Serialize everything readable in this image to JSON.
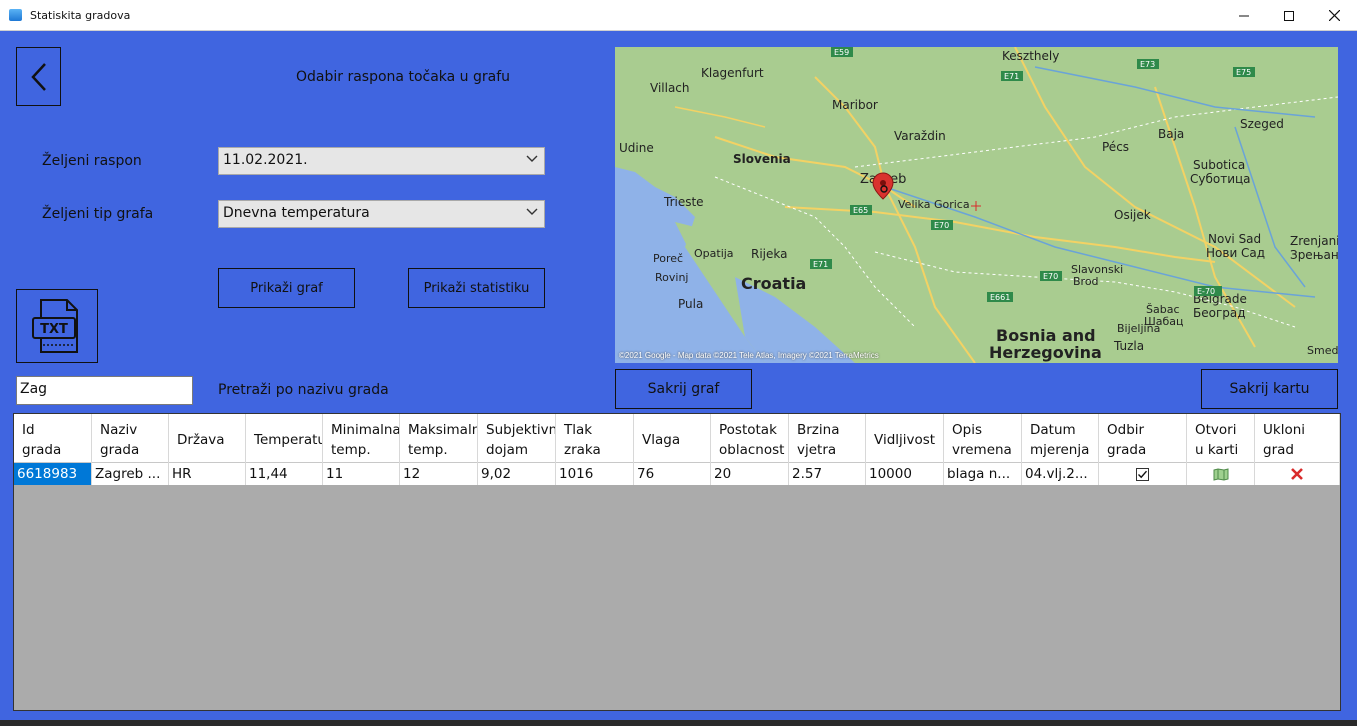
{
  "window": {
    "title": "Statiskita gradova"
  },
  "controls": {
    "heading": "Odabir raspona točaka u grafu",
    "range_label": "Željeni raspon",
    "range_value": "11.02.2021.",
    "type_label": "Željeni tip grafa",
    "type_value": "Dnevna temperatura",
    "show_graph": "Prikaži graf",
    "show_stats": "Prikaži statistiku",
    "txt_label": "TXT",
    "search_value": "Zag",
    "search_label": "Pretraži po nazivu grada",
    "hide_graph": "Sakrij graf",
    "hide_map": "Sakrij kartu"
  },
  "map": {
    "labels": [
      {
        "text": "Keszthely"
      },
      {
        "text": "Klagenfurt"
      },
      {
        "text": "Villach"
      },
      {
        "text": "Maribor"
      },
      {
        "text": "Varaždin"
      },
      {
        "text": "Szeged"
      },
      {
        "text": "Udine"
      },
      {
        "text": "Slovenia"
      },
      {
        "text": "Baja"
      },
      {
        "text": "Pécs"
      },
      {
        "text": "Subotica"
      },
      {
        "text": "Суботица"
      },
      {
        "text": "Zagreb"
      },
      {
        "text": "Trieste"
      },
      {
        "text": "Velika Gorica"
      },
      {
        "text": "Osijek"
      },
      {
        "text": "Novi Sad"
      },
      {
        "text": "Нови Сад"
      },
      {
        "text": "Zrenjani"
      },
      {
        "text": "Зрењани"
      },
      {
        "text": "Poreč"
      },
      {
        "text": "Opatija"
      },
      {
        "text": "Rijeka"
      },
      {
        "text": "Rovinj"
      },
      {
        "text": "Croatia"
      },
      {
        "text": "Slavonski"
      },
      {
        "text": "Brod"
      },
      {
        "text": "Pula"
      },
      {
        "text": "Belgrade"
      },
      {
        "text": "Београд"
      },
      {
        "text": "Šabac"
      },
      {
        "text": "Шабац"
      },
      {
        "text": "Bijeljina"
      },
      {
        "text": "Bosnia and"
      },
      {
        "text": "Herzegovina"
      },
      {
        "text": "Tuzla"
      },
      {
        "text": "Smede"
      }
    ],
    "roads": [
      "E59",
      "E71",
      "E73",
      "E75",
      "E65",
      "E70",
      "E71",
      "E70",
      "E661",
      "E-70"
    ],
    "copyright": "©2021 Google - Map data ©2021 Tele Atlas, Imagery ©2021 TerraMetrics"
  },
  "table": {
    "headers": [
      "Id grada",
      "Naziv grada",
      "Država",
      "Temperatura",
      "Minimalna temp.",
      "Maksimalna temp.",
      "Subjektivni dojam",
      "Tlak zraka",
      "Vlaga",
      "Postotak oblacnosti",
      "Brzina vjetra",
      "Vidljivost",
      "Opis vremena",
      "Datum mjerenja",
      "Odbir grada",
      "Otvori u karti",
      "Ukloni grad"
    ],
    "header_lines": [
      [
        "Id",
        "grada"
      ],
      [
        "Naziv",
        "grada"
      ],
      [
        "Država",
        ""
      ],
      [
        "Temperatu",
        ""
      ],
      [
        "Minimalna",
        "temp."
      ],
      [
        "Maksimaln",
        "temp."
      ],
      [
        "Subjektivn",
        "dojam"
      ],
      [
        "Tlak",
        "zraka"
      ],
      [
        "Vlaga",
        ""
      ],
      [
        "Postotak",
        "oblacnost"
      ],
      [
        "Brzina",
        "vjetra"
      ],
      [
        "Vidljivost",
        ""
      ],
      [
        "Opis",
        "vremena"
      ],
      [
        "Datum",
        "mjerenja"
      ],
      [
        "Odbir",
        "grada"
      ],
      [
        "Otvori",
        "u karti"
      ],
      [
        "Ukloni",
        "grad"
      ]
    ],
    "rows": [
      {
        "id": "6618983",
        "name": "Zagreb ...",
        "country": "HR",
        "temp": "11,44",
        "min": "11",
        "max": "12",
        "feels": "9,02",
        "pressure": "1016",
        "humidity": "76",
        "clouds": "20",
        "wind": "2.57",
        "visibility": "10000",
        "desc": "blaga n...",
        "date": "04.vlj.2...",
        "selected": true
      }
    ]
  },
  "colors": {
    "background": "#4065e0",
    "selection": "#0078d7",
    "remove": "#d92b2b"
  }
}
